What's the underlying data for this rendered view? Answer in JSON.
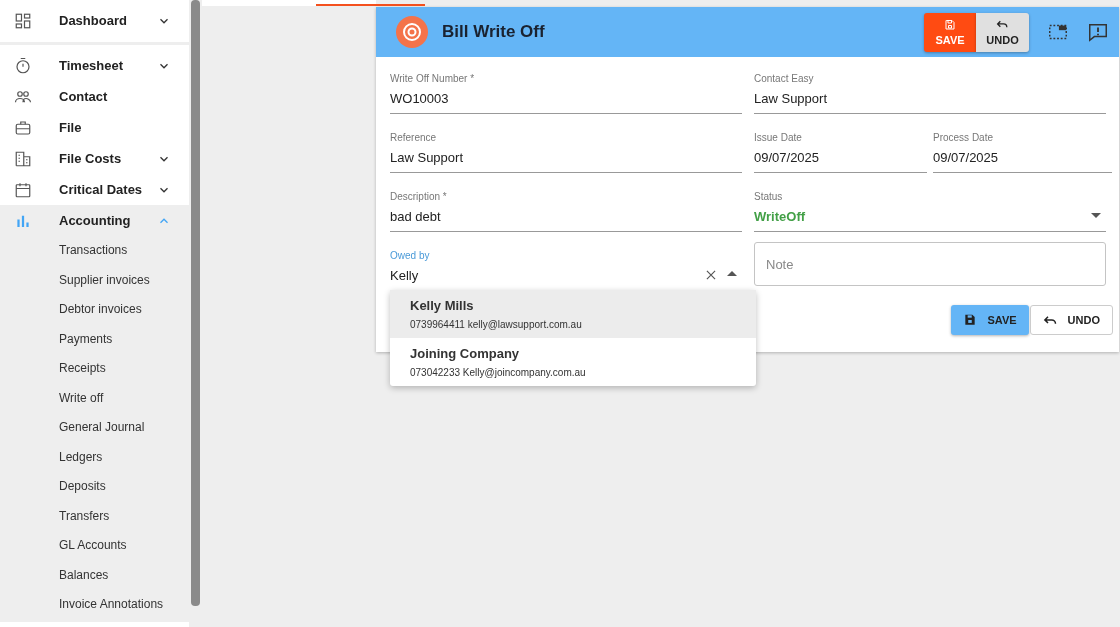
{
  "sidebar": {
    "items": [
      {
        "label": "Dashboard",
        "expanded": false,
        "selected": false
      },
      {
        "label": "Timesheet",
        "expanded": false,
        "selected": false
      },
      {
        "label": "Contact",
        "selected": false
      },
      {
        "label": "File",
        "selected": false
      },
      {
        "label": "File Costs",
        "expanded": false,
        "selected": false
      },
      {
        "label": "Critical Dates",
        "expanded": false,
        "selected": false
      },
      {
        "label": "Accounting",
        "expanded": true,
        "selected": true,
        "children": [
          {
            "label": "Transactions"
          },
          {
            "label": "Supplier invoices"
          },
          {
            "label": "Debtor invoices"
          },
          {
            "label": "Payments"
          },
          {
            "label": "Receipts"
          },
          {
            "label": "Write off"
          },
          {
            "label": "General Journal"
          },
          {
            "label": "Ledgers"
          },
          {
            "label": "Deposits"
          },
          {
            "label": "Transfers"
          },
          {
            "label": "GL Accounts"
          },
          {
            "label": "Balances"
          },
          {
            "label": "Invoice Annotations"
          }
        ]
      }
    ]
  },
  "dialog": {
    "title": "Bill Write Off",
    "header_buttons": [
      {
        "label": "SAVE",
        "kind": "save"
      },
      {
        "label": "UNDO",
        "kind": "undo"
      }
    ],
    "fields": {
      "write_off_number": {
        "label": "Write Off Number *",
        "value": "WO10003"
      },
      "contact_easy": {
        "label": "Contact Easy",
        "value": "Law Support"
      },
      "reference": {
        "label": "Reference",
        "value": "Law Support"
      },
      "issue_date": {
        "label": "Issue Date",
        "value": "09/07/2025"
      },
      "process_date": {
        "label": "Process Date",
        "value": "09/07/2025"
      },
      "description": {
        "label": "Description *",
        "value": "bad debt"
      },
      "status": {
        "label": "Status",
        "value": "WriteOff"
      },
      "owed_by": {
        "label": "Owed by",
        "value": "Kelly",
        "focused": true
      },
      "note": {
        "placeholder": "Note"
      }
    },
    "dropdown": [
      {
        "name": "Kelly Mills",
        "detail": "0739964411 kelly@lawsupport.com.au",
        "selected": true
      },
      {
        "name": "Joining Company",
        "detail": "073042233 Kelly@joincompany.com.au",
        "selected": false
      }
    ],
    "footer_buttons": [
      {
        "label": "SAVE",
        "kind": "save"
      },
      {
        "label": "UNDO",
        "kind": "undo"
      }
    ]
  }
}
